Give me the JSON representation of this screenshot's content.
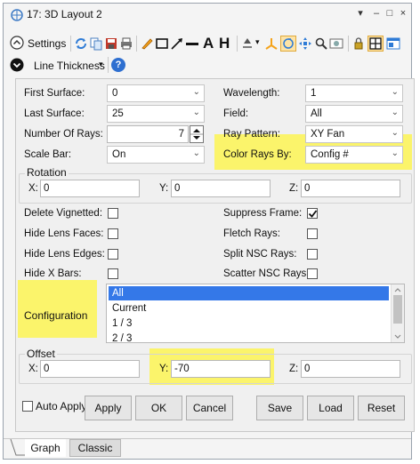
{
  "window": {
    "title": "17: 3D Layout 2",
    "controls": [
      "▾",
      "–",
      "□",
      "×"
    ]
  },
  "toolbar": {
    "settings_label": "Settings",
    "line_thickness_label": "Line Thickness",
    "line_thickness_arrow": "▾",
    "help_label": "?",
    "zoom_arrow": "▾",
    "text_tool": "A",
    "dim_tool": "H"
  },
  "form": {
    "first_surface": {
      "label": "First Surface:",
      "value": "0"
    },
    "last_surface": {
      "label": "Last Surface:",
      "value": "25"
    },
    "number_of_rays": {
      "label": "Number Of Rays:",
      "value": "7"
    },
    "scale_bar": {
      "label": "Scale Bar:",
      "value": "On"
    },
    "wavelength": {
      "label": "Wavelength:",
      "value": "1"
    },
    "field": {
      "label": "Field:",
      "value": "All"
    },
    "ray_pattern": {
      "label": "Ray Pattern:",
      "value": "XY Fan"
    },
    "color_rays_by": {
      "label": "Color Rays By:",
      "value": "Config #"
    },
    "dropdown_arrow": "⌄",
    "rotation": {
      "label": "Rotation",
      "x_label": "X:",
      "x_value": "0",
      "y_label": "Y:",
      "y_value": "0",
      "z_label": "Z:",
      "z_value": "0"
    },
    "checks": {
      "delete_vignetted": {
        "label": "Delete Vignetted:",
        "checked": false
      },
      "hide_lens_faces": {
        "label": "Hide Lens Faces:",
        "checked": false
      },
      "hide_lens_edges": {
        "label": "Hide Lens Edges:",
        "checked": false
      },
      "hide_x_bars": {
        "label": "Hide X Bars:",
        "checked": false
      },
      "suppress_frame": {
        "label": "Suppress Frame:",
        "checked": true
      },
      "fletch_rays": {
        "label": "Fletch Rays:",
        "checked": false
      },
      "split_nsc_rays": {
        "label": "Split NSC Rays:",
        "checked": false
      },
      "scatter_nsc_rays": {
        "label": "Scatter NSC Rays:",
        "checked": false
      }
    },
    "configuration": {
      "label": "Configuration",
      "items": [
        "All",
        "Current",
        "1 / 3",
        "2 / 3"
      ],
      "selected": "All"
    },
    "offset": {
      "label": "Offset",
      "x_label": "X:",
      "x_value": "0",
      "y_label": "Y:",
      "y_value": "-70",
      "z_label": "Z:",
      "z_value": "0"
    }
  },
  "buttons": {
    "auto_apply": "Auto Apply",
    "apply": "Apply",
    "ok": "OK",
    "cancel": "Cancel",
    "save": "Save",
    "load": "Load",
    "reset": "Reset"
  },
  "tabs": [
    "Graph",
    "Classic"
  ],
  "colors": {
    "highlight": "#fbf46b",
    "selection": "#3478e8",
    "accent_orange": "#f5a31a"
  }
}
